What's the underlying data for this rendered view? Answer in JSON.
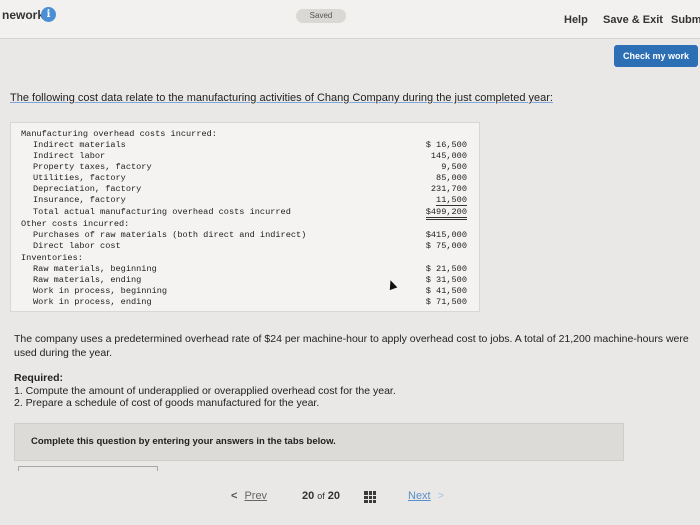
{
  "topbar": {
    "title": "nework",
    "saved": "Saved",
    "help": "Help",
    "save_exit": "Save & Exit",
    "submit": "Submi"
  },
  "check_work": "Check my work",
  "intro": "The following cost data relate to the manufacturing activities of Chang Company during the just completed year:",
  "table": {
    "mfg_header": "Manufacturing overhead costs incurred:",
    "mfg_items": [
      {
        "label": "Indirect materials",
        "amount": "$ 16,500"
      },
      {
        "label": "Indirect labor",
        "amount": "145,000"
      },
      {
        "label": "Property taxes, factory",
        "amount": "9,500"
      },
      {
        "label": "Utilities, factory",
        "amount": "85,000"
      },
      {
        "label": "Depreciation, factory",
        "amount": "231,700"
      },
      {
        "label": "Insurance, factory",
        "amount": "11,500"
      }
    ],
    "mfg_total": {
      "label": "Total actual manufacturing overhead costs incurred",
      "amount": "$499,200"
    },
    "other_header": "Other costs incurred:",
    "other_items": [
      {
        "label": "Purchases of raw materials (both direct and indirect)",
        "amount": "$415,000"
      },
      {
        "label": "Direct labor cost",
        "amount": "$ 75,000"
      }
    ],
    "inv_header": "Inventories:",
    "inv_items": [
      {
        "label": "Raw materials, beginning",
        "amount": "$ 21,500"
      },
      {
        "label": "Raw materials, ending",
        "amount": "$ 31,500"
      },
      {
        "label": "Work in process, beginning",
        "amount": "$ 41,500"
      },
      {
        "label": "Work in process, ending",
        "amount": "$ 71,500"
      }
    ]
  },
  "paragraph": "The company uses a predetermined overhead rate of $24 per machine-hour to apply overhead cost to jobs. A total of 21,200 machine-hours were used during the year.",
  "required": {
    "title": "Required:",
    "items": [
      "1. Compute the amount of underapplied or overapplied overhead cost for the year.",
      "2. Prepare a schedule of cost of goods manufactured for the year."
    ]
  },
  "complete_note": "Complete this question by entering your answers in the tabs below.",
  "pager": {
    "prev": "Prev",
    "current": "20",
    "of": "of",
    "total": "20",
    "next": "Next"
  },
  "icons": {
    "info": "info-icon",
    "grid": "grid-icon",
    "prev_arrow": "chevron-left-icon",
    "next_arrow": "chevron-right-icon"
  },
  "colors": {
    "accent": "#2d6fb5",
    "link": "#5a8fc9"
  }
}
